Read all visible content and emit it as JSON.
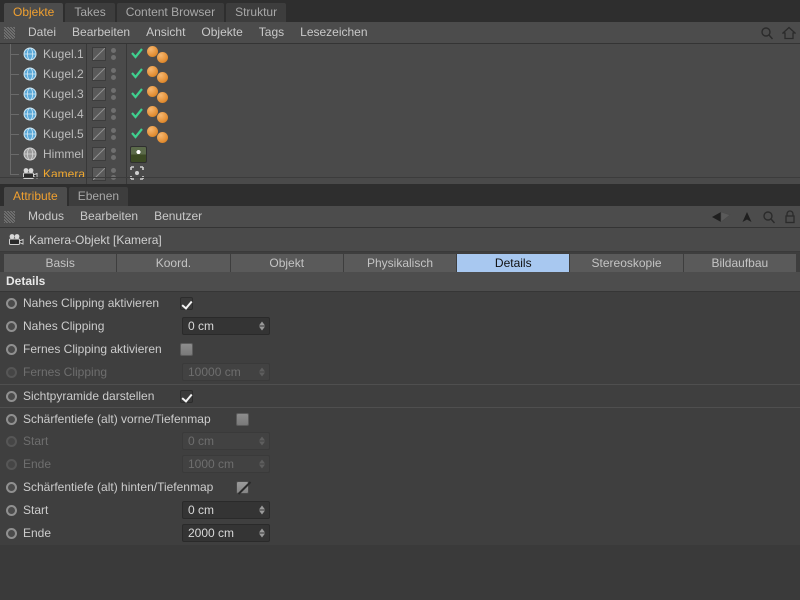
{
  "object_manager": {
    "tabs": [
      {
        "label": "Objekte",
        "active": true
      },
      {
        "label": "Takes",
        "active": false
      },
      {
        "label": "Content Browser",
        "active": false
      },
      {
        "label": "Struktur",
        "active": false
      }
    ],
    "menu": [
      "Datei",
      "Bearbeiten",
      "Ansicht",
      "Objekte",
      "Tags",
      "Lesezeichen"
    ],
    "right_icons": [
      "search-icon",
      "home-icon"
    ],
    "objects": [
      {
        "name": "Kugel.1",
        "type": "sphere",
        "selected": false,
        "tag": "check",
        "materials": 2
      },
      {
        "name": "Kugel.2",
        "type": "sphere",
        "selected": false,
        "tag": "check",
        "materials": 2
      },
      {
        "name": "Kugel.3",
        "type": "sphere",
        "selected": false,
        "tag": "check",
        "materials": 2
      },
      {
        "name": "Kugel.4",
        "type": "sphere",
        "selected": false,
        "tag": "check",
        "materials": 2
      },
      {
        "name": "Kugel.5",
        "type": "sphere",
        "selected": false,
        "tag": "check",
        "materials": 2
      },
      {
        "name": "Himmel",
        "type": "sky",
        "selected": false,
        "tag": "none",
        "materials": 0,
        "thumbnail": "sky-material"
      },
      {
        "name": "Kamera",
        "type": "camera",
        "selected": true,
        "tag": "target",
        "materials": 0
      }
    ]
  },
  "attribute_manager": {
    "tabs": [
      {
        "label": "Attribute",
        "active": true
      },
      {
        "label": "Ebenen",
        "active": false
      }
    ],
    "menu": [
      "Modus",
      "Bearbeiten",
      "Benutzer"
    ],
    "right_icons": [
      "back-arrow-icon",
      "up-arrow-icon",
      "search-icon",
      "lock-icon"
    ],
    "object_title": "Kamera-Objekt [Kamera]",
    "property_tabs": [
      {
        "label": "Basis",
        "active": false
      },
      {
        "label": "Koord.",
        "active": false
      },
      {
        "label": "Objekt",
        "active": false
      },
      {
        "label": "Physikalisch",
        "active": false
      },
      {
        "label": "Details",
        "active": true
      },
      {
        "label": "Stereoskopie",
        "active": false
      },
      {
        "label": "Bildaufbau",
        "active": false
      }
    ],
    "section_title": "Details",
    "properties": [
      {
        "label": "Nahes Clipping aktivieren",
        "control": "checkbox",
        "state": "on",
        "disabled": false,
        "dotted": false,
        "sep": false
      },
      {
        "label": "Nahes Clipping",
        "control": "number",
        "value": "0 cm",
        "disabled": false,
        "dotted": true,
        "sep": false
      },
      {
        "label": "Fernes Clipping aktivieren",
        "control": "checkbox",
        "state": "off",
        "disabled": false,
        "dotted": false,
        "sep": false
      },
      {
        "label": "Fernes Clipping",
        "control": "number",
        "value": "10000 cm",
        "disabled": true,
        "dotted": true,
        "sep": false
      },
      {
        "label": "Sichtpyramide darstellen",
        "control": "checkbox",
        "state": "on",
        "disabled": false,
        "dotted": false,
        "sep": true
      },
      {
        "label": "Schärfentiefe (alt) vorne/Tiefenmap",
        "control": "checkbox",
        "state": "off",
        "disabled": false,
        "dotted": false,
        "sep": true
      },
      {
        "label": "Start",
        "control": "number",
        "value": "0 cm",
        "disabled": true,
        "dotted": true,
        "sep": false
      },
      {
        "label": "Ende",
        "control": "number",
        "value": "1000 cm",
        "disabled": true,
        "dotted": true,
        "sep": false
      },
      {
        "label": "Schärfentiefe (alt) hinten/Tiefenmap",
        "control": "checkbox",
        "state": "slash",
        "disabled": false,
        "dotted": false,
        "sep": false
      },
      {
        "label": "Start",
        "control": "number",
        "value": "0 cm",
        "disabled": false,
        "dotted": true,
        "sep": false
      },
      {
        "label": "Ende",
        "control": "number",
        "value": "2000 cm",
        "disabled": false,
        "dotted": true,
        "sep": false
      }
    ]
  },
  "colors": {
    "accent": "#f0a830",
    "panel": "#4a4a4a",
    "body": "#3f3f3f",
    "tab_active": "#a8c8f0",
    "material_orange": "#e08a2e",
    "check_green": "#3fcf8e"
  }
}
